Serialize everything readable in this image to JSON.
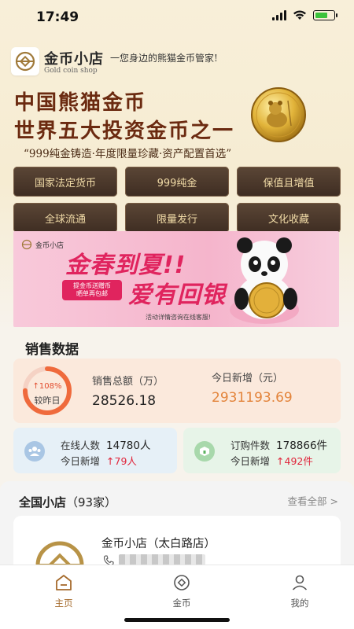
{
  "status": {
    "time": "17:49"
  },
  "brand": {
    "name": "金币小店",
    "sub": "Gold coin shop",
    "slogan": "一您身边的熊猫金币管家!"
  },
  "hero": {
    "headline1": "中国熊猫金币",
    "headline2": "世界五大投资金币之一",
    "tagline": "“999纯金铸造·年度限量珍藏·资产配置首选”"
  },
  "features": [
    "国家法定货币",
    "999纯金",
    "保值且增值",
    "全球流通",
    "限量发行",
    "文化收藏"
  ],
  "banner": {
    "logo_text": "金币小店",
    "line1": "金春到夏!!",
    "line2": "爱有回银",
    "chip_line1": "提金币送赠币",
    "chip_line2": "晒单再包邮",
    "foot": "活动详情咨询在线客服!"
  },
  "sales": {
    "title": "销售数据",
    "ring_pct": "↑108%",
    "ring_label": "较昨日",
    "ring_fraction": 0.75,
    "total_label": "销售总额（万）",
    "total_value": "28526.18",
    "today_label": "今日新增（元）",
    "today_value": "2931193.69"
  },
  "online": {
    "label": "在线人数",
    "value": "14780人",
    "today_label": "今日新增",
    "today_value": "↑79人"
  },
  "orders": {
    "label": "订购件数",
    "value": "178866件",
    "today_label": "今日新增",
    "today_value": "↑492件"
  },
  "shops": {
    "title": "全国小店",
    "count": "（93家）",
    "view_all": "查看全部 >",
    "first_shop_name": "金币小店（太白路店）"
  },
  "tabs": [
    {
      "label": "主页",
      "icon": "home-icon"
    },
    {
      "label": "金币",
      "icon": "coin-icon"
    },
    {
      "label": "我的",
      "icon": "user-icon"
    }
  ],
  "colors": {
    "accent": "#a56a2c",
    "brown": "#6b2a10",
    "pink": "#e0245e",
    "up": "#e0243a"
  }
}
